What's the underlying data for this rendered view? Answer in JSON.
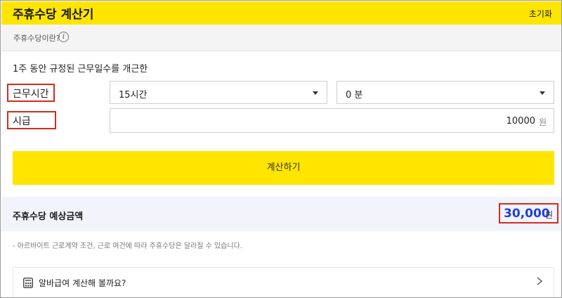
{
  "header": {
    "title": "주휴수당 계산기",
    "reset_label": "초기화"
  },
  "info": {
    "text": "주휴수당이란?",
    "icon_glyph": "i"
  },
  "instruction": "1주 동안 규정된 근무일수를 개근한",
  "labels": {
    "hours": "근무시간",
    "wage": "시급"
  },
  "selects": {
    "hours_value": "15시간",
    "minutes_value": "0 분"
  },
  "wage": {
    "value": "10000",
    "unit": "원"
  },
  "calc_button": "계산하기",
  "result": {
    "label": "주휴수당 예상금액",
    "amount": "30,000",
    "unit": "원"
  },
  "notice": "- 아르바이트 근로계약 조건, 근로 여건에 따라 주휴수당은 달라질 수 있습니다.",
  "promo": {
    "text": "알바급여 계산해 볼까요?"
  },
  "colors": {
    "accent": "#ffe500",
    "highlight": "#d22d1e",
    "amount": "#1f3fd6"
  }
}
